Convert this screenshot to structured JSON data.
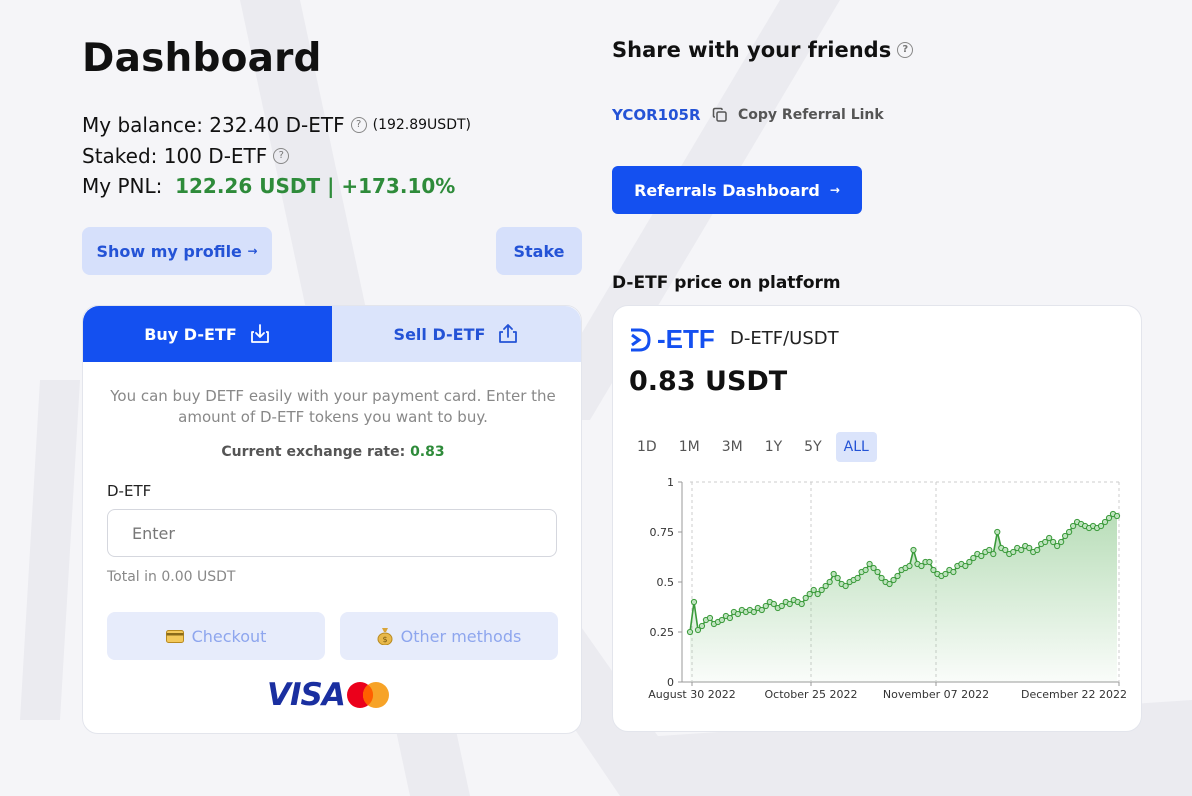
{
  "dashboard": {
    "title": "Dashboard",
    "balance_label": "My balance:",
    "balance_value": "232.40 D-ETF",
    "balance_usdt": "(192.89USDT)",
    "staked_label": "Staked:",
    "staked_value": "100 D-ETF",
    "pnl_label": "My PNL:",
    "pnl_value": "122.26 USDT | +173.10%",
    "help_glyph": "?"
  },
  "actions": {
    "profile_label": "Show my profile",
    "profile_arrow": "→",
    "stake_label": "Stake"
  },
  "trade": {
    "tabs": [
      {
        "label": "Buy D-ETF",
        "icon": "download-icon",
        "active": true
      },
      {
        "label": "Sell D-ETF",
        "icon": "share-icon",
        "active": false
      }
    ],
    "description": "You can buy DETF easily with your payment card. Enter the amount of D-ETF tokens you want to buy.",
    "rate_label": "Current exchange rate:",
    "rate_value": "0.83",
    "field_label": "D-ETF",
    "placeholder": "Enter",
    "total_text": "Total in 0.00 USDT",
    "checkout_label": "Checkout",
    "checkout_icon": "credit-card-icon",
    "other_label": "Other methods",
    "other_icon": "money-bag-icon",
    "visa_text": "VISA"
  },
  "share": {
    "title": "Share with your friends",
    "code": "YCOR105R",
    "copy_label": "Copy Referral Link",
    "referrals_label": "Referrals Dashboard",
    "referrals_arrow": "→"
  },
  "price": {
    "section_title": "D-ETF price on platform",
    "logo_text": "-ETF",
    "pair": "D-ETF/USDT",
    "current": "0.83 USDT",
    "ranges": [
      "1D",
      "1M",
      "3M",
      "1Y",
      "5Y",
      "ALL"
    ],
    "active_range": "ALL"
  },
  "colors": {
    "primary": "#1450f0",
    "soft": "#d6e0fb",
    "positive": "#2e8b3a",
    "chart_line": "#3a9a3a"
  },
  "chart_data": {
    "type": "area",
    "x_ticks": [
      "August 30 2022",
      "October 25 2022",
      "November 07 2022",
      "December 22 2022"
    ],
    "y_ticks": [
      0,
      0.25,
      0.5,
      0.75,
      1
    ],
    "ylim": [
      0,
      1
    ],
    "grid": true,
    "values": [
      0.25,
      0.4,
      0.26,
      0.28,
      0.31,
      0.32,
      0.29,
      0.3,
      0.31,
      0.33,
      0.32,
      0.35,
      0.34,
      0.36,
      0.35,
      0.36,
      0.35,
      0.37,
      0.36,
      0.38,
      0.4,
      0.39,
      0.37,
      0.38,
      0.4,
      0.39,
      0.41,
      0.4,
      0.39,
      0.42,
      0.44,
      0.46,
      0.44,
      0.46,
      0.48,
      0.5,
      0.54,
      0.52,
      0.49,
      0.48,
      0.5,
      0.51,
      0.52,
      0.55,
      0.56,
      0.59,
      0.57,
      0.55,
      0.52,
      0.5,
      0.49,
      0.51,
      0.53,
      0.56,
      0.57,
      0.58,
      0.66,
      0.59,
      0.58,
      0.6,
      0.6,
      0.56,
      0.54,
      0.53,
      0.54,
      0.56,
      0.55,
      0.58,
      0.59,
      0.58,
      0.6,
      0.62,
      0.64,
      0.63,
      0.65,
      0.66,
      0.64,
      0.75,
      0.67,
      0.66,
      0.64,
      0.65,
      0.67,
      0.66,
      0.68,
      0.67,
      0.65,
      0.66,
      0.69,
      0.7,
      0.72,
      0.7,
      0.68,
      0.7,
      0.73,
      0.75,
      0.78,
      0.8,
      0.79,
      0.78,
      0.77,
      0.78,
      0.77,
      0.78,
      0.8,
      0.82,
      0.84,
      0.83
    ]
  }
}
